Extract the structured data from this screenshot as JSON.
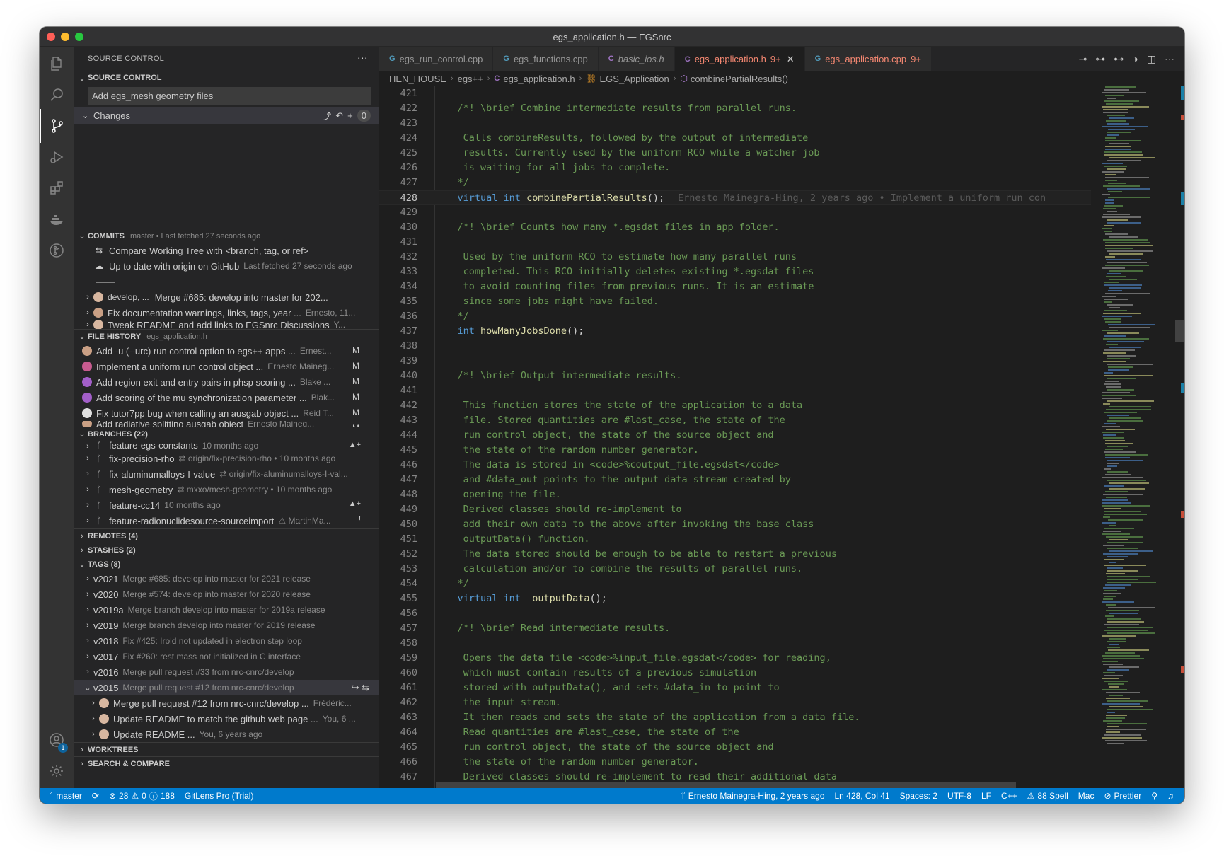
{
  "window": {
    "title": "egs_application.h — EGSnrc"
  },
  "activity_bar": [
    "explorer",
    "search",
    "source-control",
    "run-debug",
    "extensions",
    "docker",
    "gitlens",
    "accounts",
    "settings"
  ],
  "accounts_badge": "1",
  "sidebar": {
    "title": "SOURCE CONTROL",
    "source_control": {
      "label": "SOURCE CONTROL",
      "commit_message": "Add egs_mesh geometry files",
      "changes_label": "Changes",
      "changes_count": "0"
    },
    "commits": {
      "label": "COMMITS",
      "sub": "master • Last fetched 27 seconds ago",
      "compare": "Compare Working Tree with <branch, tag, or ref>",
      "uptodate": "Up to date with origin on GitHub",
      "uptodate_desc": "Last fetched 27 seconds ago",
      "divider": "——",
      "items": [
        {
          "label": "Merge #685: develop into master for 202...",
          "prefix": "develop, ..."
        },
        {
          "label": "Fix documentation warnings, links, tags, year ...",
          "desc": "Ernesto, 11..."
        },
        {
          "label": "Tweak README and add links to EGSnrc Discussions",
          "desc": "Y..."
        }
      ]
    },
    "file_history": {
      "label": "FILE HISTORY",
      "sub": "egs_application.h",
      "items": [
        {
          "label": "Add -u (--urc) run control option to egs++ apps ...",
          "desc": "Ernest...",
          "status": "M"
        },
        {
          "label": "Implement a uniform run control object ...",
          "desc": "Ernesto Maineg...",
          "status": "M"
        },
        {
          "label": "Add region exit and entry pairs in phsp scoring ...",
          "desc": "Blake ...",
          "status": "M"
        },
        {
          "label": "Add scoring of the mu synchronization parameter ...",
          "desc": "Blak...",
          "status": "M"
        },
        {
          "label": "Fix tutor7pp bug when calling an ausgab object ...",
          "desc": "Reid T...",
          "status": "M"
        },
        {
          "label": "Add radiative splitting ausgab object",
          "desc": "Ernesto Maineg...",
          "status": "M"
        }
      ]
    },
    "branches": {
      "label": "BRANCHES (22)",
      "items": [
        {
          "label": "feature-egs-constants",
          "desc": "10 months ago",
          "stat": "▲+"
        },
        {
          "label": "fix-precision-rho",
          "desc": "⇄ origin/fix-precision-rho  •  10 months ago",
          "stat": ""
        },
        {
          "label": "fix-aluminumalloys-I-value",
          "desc": "⇄ origin/fix-aluminumalloys-I-val...",
          "stat": ""
        },
        {
          "label": "mesh-geometry",
          "desc": "⇄ mxxo/mesh-geometry  •  10 months ago",
          "stat": ""
        },
        {
          "label": "feature-cc14",
          "desc": "10 months ago",
          "stat": "▲+"
        },
        {
          "label": "feature-radionuclidesource-sourceimport",
          "desc": "⚠ MartinMa...",
          "stat": "!"
        }
      ]
    },
    "remotes": {
      "label": "REMOTES (4)"
    },
    "stashes": {
      "label": "STASHES (2)"
    },
    "tags": {
      "label": "TAGS (8)",
      "items": [
        {
          "name": "v2021",
          "desc": "Merge #685: develop into master for 2021 release"
        },
        {
          "name": "v2020",
          "desc": "Merge #574: develop into master for 2020 release"
        },
        {
          "name": "v2019a",
          "desc": "Merge branch develop into master for 2019a release"
        },
        {
          "name": "v2019",
          "desc": "Merge branch develop into master for 2019 release"
        },
        {
          "name": "v2018",
          "desc": "Fix #425: Irold not updated in electron step loop"
        },
        {
          "name": "v2017",
          "desc": "Fix #260: rest mass not initialized in C interface"
        },
        {
          "name": "v2016",
          "desc": "Merge pull request #33 from nrc-cnrc/develop"
        },
        {
          "name": "v2015",
          "desc": "Merge pull request #12 from nrc-cnrc/develop"
        }
      ],
      "expanded": [
        {
          "label": "Merge pull request #12 from nrc-cnrc/develop ...",
          "desc": "Frédéric..."
        },
        {
          "label": "Update README to match the github web page ...",
          "desc": "You, 6 ..."
        },
        {
          "label": "Update README ...",
          "desc": "You, 6 years ago"
        }
      ]
    },
    "worktrees": {
      "label": "WORKTREES"
    },
    "search_compare": {
      "label": "SEARCH & COMPARE"
    }
  },
  "editor": {
    "tabs": [
      {
        "label": "egs_run_control.cpp",
        "icon": "G",
        "mod": "",
        "kind": "cpp"
      },
      {
        "label": "egs_functions.cpp",
        "icon": "G",
        "mod": "",
        "kind": "cpp"
      },
      {
        "label": "basic_ios.h",
        "icon": "C",
        "mod": "",
        "kind": "h"
      },
      {
        "label": "egs_application.h",
        "icon": "C",
        "mod": "9+",
        "kind": "h-active"
      },
      {
        "label": "egs_application.cpp",
        "icon": "G",
        "mod": "9+",
        "kind": "cpp-mod"
      }
    ],
    "breadcrumb": {
      "p1": "HEN_HOUSE",
      "p2": "egs++",
      "p3": "egs_application.h",
      "p4": "EGS_Application",
      "p5": "combinePartialResults()"
    },
    "blame": "Ernesto Mainegra-Hing, 2 years ago • Implement a uniform run con",
    "lines": [
      {
        "n": "421",
        "t": ""
      },
      {
        "n": "422",
        "t": "/*! \\brief Combine intermediate results from parallel runs."
      },
      {
        "n": "423",
        "t": ""
      },
      {
        "n": "424",
        "t": " Calls combineResults, followed by the output of intermediate"
      },
      {
        "n": "425",
        "t": " results. Currently used by the uniform RCO while a watcher job"
      },
      {
        "n": "426",
        "t": " is waiting for all jobs to complete."
      },
      {
        "n": "427",
        "t": "*/"
      },
      {
        "n": "428",
        "t": "virtual int combinePartialResults();"
      },
      {
        "n": "429",
        "t": ""
      },
      {
        "n": "430",
        "t": "/*! \\brief Counts how many *.egsdat files in app folder."
      },
      {
        "n": "431",
        "t": ""
      },
      {
        "n": "432",
        "t": " Used by the uniform RCO to estimate how many parallel runs"
      },
      {
        "n": "433",
        "t": " completed. This RCO initially deletes existing *.egsdat files"
      },
      {
        "n": "434",
        "t": " to avoid counting files from previous runs. It is an estimate"
      },
      {
        "n": "435",
        "t": " since some jobs might have failed."
      },
      {
        "n": "436",
        "t": "*/"
      },
      {
        "n": "437",
        "t": "int howManyJobsDone();"
      },
      {
        "n": "438",
        "t": ""
      },
      {
        "n": "439",
        "t": ""
      },
      {
        "n": "440",
        "t": "/*! \\brief Output intermediate results."
      },
      {
        "n": "441",
        "t": ""
      },
      {
        "n": "442",
        "t": " This function stores the state of the application to a data"
      },
      {
        "n": "443",
        "t": " file. Stored quantities are #last_case, the state of the"
      },
      {
        "n": "444",
        "t": " run control object, the state of the source object and"
      },
      {
        "n": "445",
        "t": " the state of the random number generator."
      },
      {
        "n": "446",
        "t": " The data is stored in <code>%coutput_file.egsdat</code>"
      },
      {
        "n": "447",
        "t": " and #data_out points to the output data stream created by"
      },
      {
        "n": "448",
        "t": " opening the file."
      },
      {
        "n": "449",
        "t": " Derived classes should re-implement to"
      },
      {
        "n": "450",
        "t": " add their own data to the above after invoking the base class"
      },
      {
        "n": "451",
        "t": " outputData() function."
      },
      {
        "n": "452",
        "t": " The data stored should be enough to be able to restart a previous"
      },
      {
        "n": "453",
        "t": " calculation and/or to combine the results of parallel runs."
      },
      {
        "n": "454",
        "t": "*/"
      },
      {
        "n": "455",
        "t": "virtual int  outputData();"
      },
      {
        "n": "456",
        "t": ""
      },
      {
        "n": "457",
        "t": "/*! \\brief Read intermediate results."
      },
      {
        "n": "458",
        "t": ""
      },
      {
        "n": "459",
        "t": " Opens the data file <code>%input_file.egsdat</code> for reading,"
      },
      {
        "n": "460",
        "t": " which must contain results of a previous simulation"
      },
      {
        "n": "461",
        "t": " stored with outputData(), and sets #data_in to point to"
      },
      {
        "n": "462",
        "t": " the input stream."
      },
      {
        "n": "463",
        "t": " It then reads and sets the state of the application from a data file."
      },
      {
        "n": "464",
        "t": " Read quantities are #last_case, the state of the"
      },
      {
        "n": "465",
        "t": " run control object, the state of the source object and"
      },
      {
        "n": "466",
        "t": " the state of the random number generator."
      },
      {
        "n": "467",
        "t": " Derived classes should re-implement to read their additional data"
      }
    ]
  },
  "statusbar": {
    "branch": "master",
    "errors": "28",
    "warnings": "0",
    "info": "188",
    "gitlens": "GitLens Pro (Trial)",
    "blame": "Ernesto Mainegra-Hing, 2 years ago",
    "position": "Ln 428, Col 41",
    "spaces": "Spaces: 2",
    "encoding": "UTF-8",
    "eol": "LF",
    "language": "C++",
    "spell": "88 Spell",
    "os": "Mac",
    "prettier": "Prettier"
  },
  "colors": {
    "accent": "#007acc",
    "modified_tab": "#f48771",
    "comment": "#6a9955",
    "keyword": "#569cd6",
    "function": "#dcdcaa"
  }
}
